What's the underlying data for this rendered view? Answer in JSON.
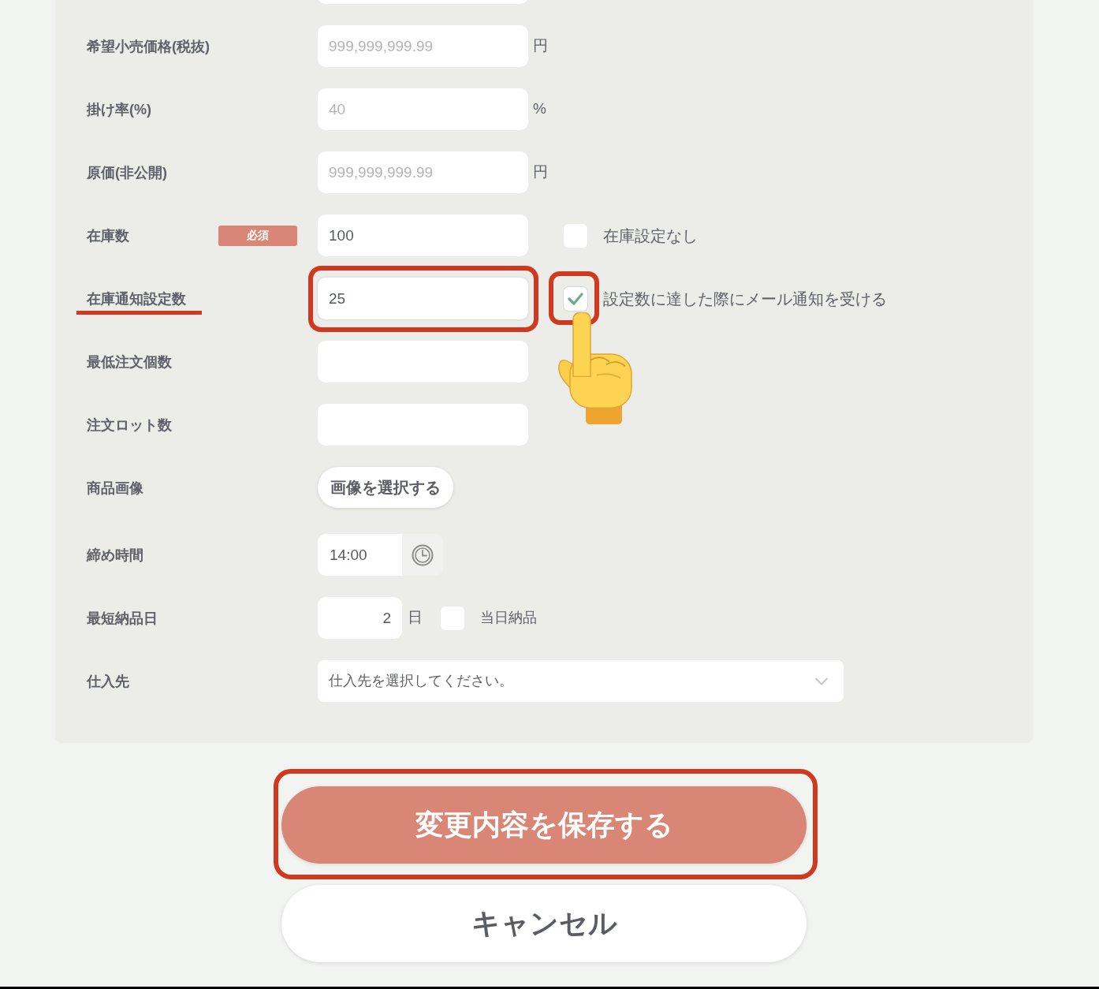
{
  "rows": [
    {
      "kind": "text",
      "label": "希望小売価格(税抜)",
      "placeholder": "999,999,999.99",
      "unit": "円"
    },
    {
      "kind": "text",
      "label": "掛け率(%)",
      "placeholder": "40",
      "unit": "%"
    },
    {
      "kind": "text",
      "label": "原価(非公開)",
      "placeholder": "999,999,999.99",
      "unit": "円"
    },
    {
      "kind": "text",
      "label": "在庫数",
      "badge": "必須",
      "value": "100",
      "checkbox": {
        "label": "在庫設定なし",
        "checked": false
      }
    },
    {
      "kind": "text",
      "label": "在庫通知設定数",
      "label_underlined": true,
      "value": "25",
      "highlighted": true,
      "checkbox": {
        "label": "設定数に達した際にメール通知を受ける",
        "checked": true,
        "highlighted": true,
        "pointer": true
      }
    },
    {
      "kind": "text",
      "label": "最低注文個数"
    },
    {
      "kind": "text",
      "label": "注文ロット数"
    },
    {
      "kind": "button",
      "label": "商品画像",
      "button": "画像を選択する"
    },
    {
      "kind": "time",
      "label": "締め時間",
      "value": "14:00"
    },
    {
      "kind": "days",
      "label": "最短納品日",
      "value": "2",
      "unit": "日",
      "checkbox": {
        "label": "当日納品",
        "checked": false
      }
    },
    {
      "kind": "select",
      "label": "仕入先",
      "placeholder": "仕入先を選択してください。"
    }
  ],
  "actions": [
    {
      "kind": "primary",
      "label": "変更内容を保存する",
      "highlighted": true
    },
    {
      "kind": "secondary",
      "label": "キャンセル",
      "highlighted": false
    }
  ]
}
